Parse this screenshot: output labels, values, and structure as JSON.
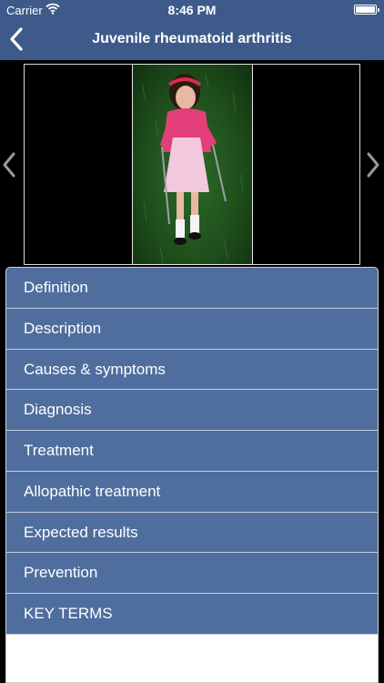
{
  "status_bar": {
    "carrier": "Carrier",
    "time": "8:46 PM"
  },
  "nav": {
    "title": "Juvenile rheumatoid arthritis"
  },
  "menu": {
    "items": [
      {
        "label": "Definition"
      },
      {
        "label": "Description"
      },
      {
        "label": "Causes & symptoms"
      },
      {
        "label": "Diagnosis"
      },
      {
        "label": "Treatment"
      },
      {
        "label": "Allopathic treatment"
      },
      {
        "label": "Expected results"
      },
      {
        "label": "Prevention"
      },
      {
        "label": "KEY TERMS"
      }
    ]
  },
  "colors": {
    "nav_bar": "#3d5a8a",
    "menu_item": "#4f6e9e",
    "background": "#000000"
  },
  "icons": {
    "back": "chevron-left-icon",
    "prev": "chevron-left-icon",
    "next": "chevron-right-icon",
    "wifi": "wifi-icon",
    "battery": "battery-icon"
  }
}
